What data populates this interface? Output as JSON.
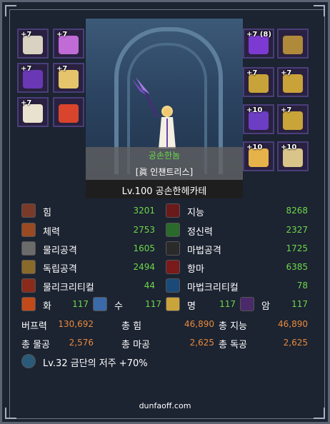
{
  "character": {
    "name": "공손한놈",
    "title": "[眞 인챈트리스]",
    "level_line": "Lv.100 공손한헤카테"
  },
  "equipment_left": [
    {
      "level": "+7",
      "art_color": "#d9d2c2"
    },
    {
      "level": "+7",
      "art_color": "#c06bd6"
    },
    {
      "level": "+7",
      "art_color": "#6a38b5"
    },
    {
      "level": "+7",
      "art_color": "#e6c46b"
    },
    {
      "level": "+7",
      "art_color": "#e8e2cf"
    },
    {
      "level": "",
      "art_color": "#d8452c"
    }
  ],
  "equipment_right": [
    {
      "level": "+7 (8)",
      "art_color": "#7d3ad3"
    },
    {
      "level": "",
      "art_color": "#b08a3b"
    },
    {
      "level": "+7",
      "art_color": "#c8a33a"
    },
    {
      "level": "+7",
      "art_color": "#caa23a"
    },
    {
      "level": "+10",
      "art_color": "#6b3ec4"
    },
    {
      "level": "+7",
      "art_color": "#c9a438"
    },
    {
      "level": "+10",
      "art_color": "#e6b24a"
    },
    {
      "level": "+10",
      "art_color": "#d9c58a"
    }
  ],
  "stats_left": [
    {
      "label": "힘",
      "value": "3201",
      "icon": "strength-icon",
      "color": "#7a3a2a"
    },
    {
      "label": "체력",
      "value": "2753",
      "icon": "vitality-icon",
      "color": "#9a4a22"
    },
    {
      "label": "물리공격",
      "value": "1605",
      "icon": "physical-attack-icon",
      "color": "#6b6b6b"
    },
    {
      "label": "독립공격",
      "value": "2494",
      "icon": "independent-attack-icon",
      "color": "#8a6a2a"
    },
    {
      "label": "물리크리티컬",
      "value": "44",
      "icon": "physical-critical-icon",
      "color": "#8a2a1a"
    }
  ],
  "stats_right": [
    {
      "label": "지능",
      "value": "8268",
      "icon": "intelligence-icon",
      "color": "#6a1a1a"
    },
    {
      "label": "정신력",
      "value": "2327",
      "icon": "spirit-icon",
      "color": "#2a6a2a"
    },
    {
      "label": "마법공격",
      "value": "1725",
      "icon": "magic-attack-icon",
      "color": "#2a2a2a"
    },
    {
      "label": "항마",
      "value": "6385",
      "icon": "defense-ignore-icon",
      "color": "#7a1a1a"
    },
    {
      "label": "마법크리티컬",
      "value": "78",
      "icon": "magic-critical-icon",
      "color": "#1a4a7a"
    }
  ],
  "elements": [
    {
      "label": "화",
      "value": "117",
      "icon": "fire-icon",
      "color": "#c04a1a"
    },
    {
      "label": "수",
      "value": "117",
      "icon": "water-icon",
      "color": "#3a6aa8"
    },
    {
      "label": "명",
      "value": "117",
      "icon": "light-icon",
      "color": "#c9a43a"
    },
    {
      "label": "암",
      "value": "117",
      "icon": "dark-icon",
      "color": "#4a2a6a"
    }
  ],
  "totals": {
    "buff_power_label": "버프력",
    "buff_power": "130,692",
    "total_str_label": "총 힘",
    "total_str": "46,890",
    "total_int_label": "총 지능",
    "total_int": "46,890",
    "total_phys_label": "총 물공",
    "total_phys": "2,576",
    "total_mag_label": "총 마공",
    "total_mag": "2,625",
    "total_ind_label": "총 독공",
    "total_ind": "2,625"
  },
  "skill_line": "Lv.32 금단의 저주 +70%",
  "site": "dunfaoff.com",
  "colors": {
    "green": "#6dd94a",
    "orange": "#e98a3c"
  }
}
